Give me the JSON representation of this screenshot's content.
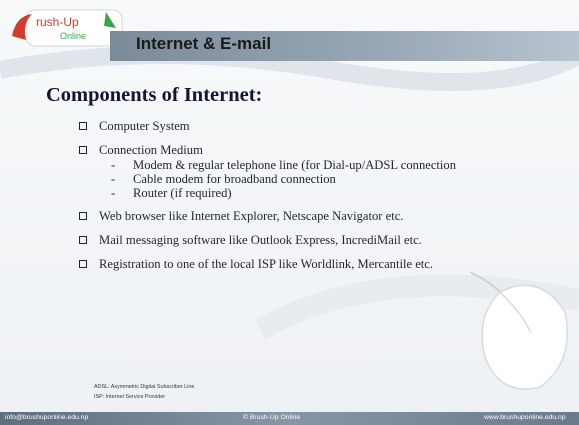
{
  "header": {
    "logo_text": "Brush-Up Online",
    "title": "Internet & E-mail"
  },
  "main": {
    "heading": "Components of Internet:",
    "items": [
      {
        "text": "Computer System"
      },
      {
        "text": "Connection Medium",
        "sub": [
          "Modem & regular telephone line (for Dial-up/ADSL connection",
          "Cable modem for broadband connection",
          "Router (if required)"
        ]
      },
      {
        "text": "Web browser like Internet Explorer, Netscape Navigator etc."
      },
      {
        "text": "Mail messaging software like Outlook Express, IncrediMail etc."
      },
      {
        "text": "Registration to one of the local ISP like Worldlink, Mercantile etc."
      }
    ],
    "sub_marker": "-"
  },
  "notes": [
    "ADSL: Asymmetric Digital Subscriber Line",
    "ISP: Internet Service Provider"
  ],
  "footer": {
    "left": "info@brushuponline.edu.np",
    "center": "© Brush-Up Online",
    "right": "www.brushuponline.edu.np"
  },
  "colors": {
    "title_bar": "#8fa0b0",
    "heading": "#121633",
    "footer": "#6a7b8b"
  },
  "icons": [
    "brush-up-logo",
    "checkbox-bullet",
    "computer-mouse-watermark"
  ]
}
